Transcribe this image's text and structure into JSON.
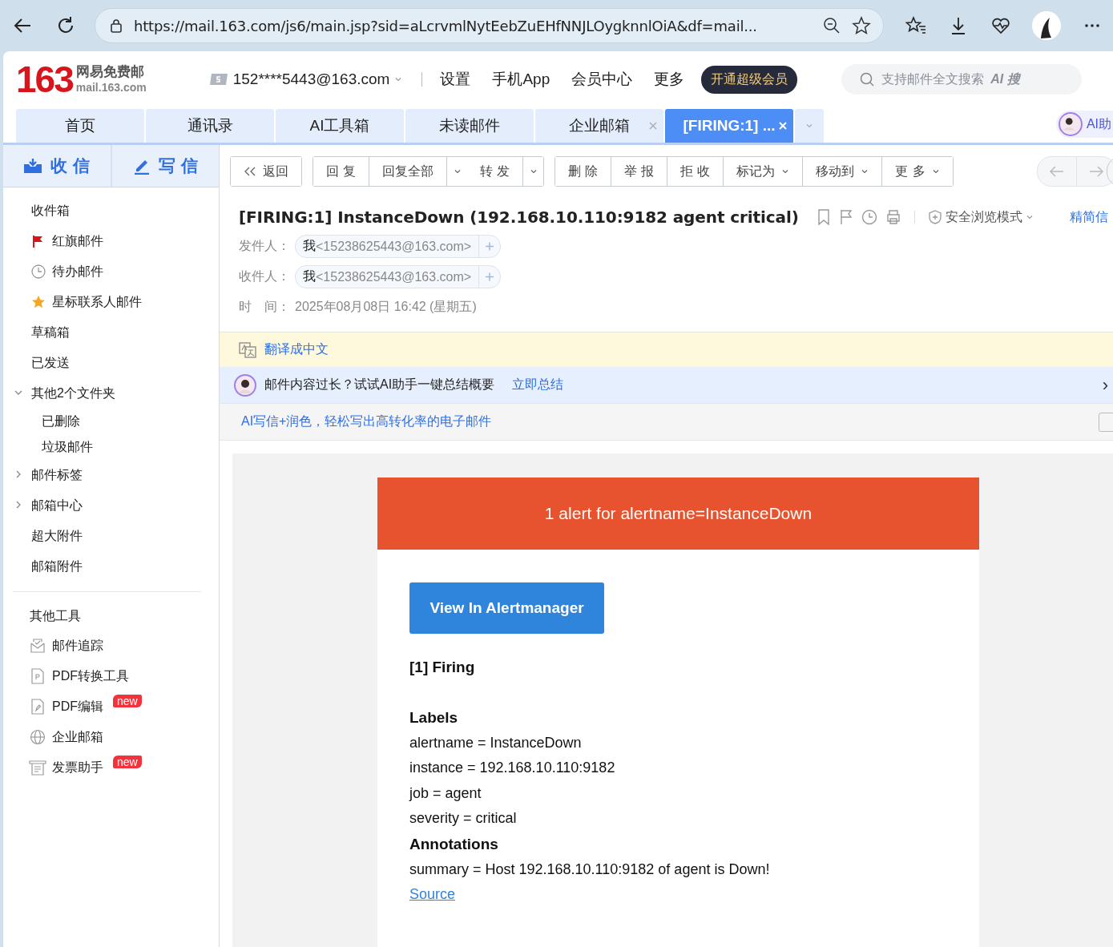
{
  "browser": {
    "url": "https://mail.163.com/js6/main.jsp?sid=aLcrvmlNytEebZuEHfNNJLOygknnlOiA&df=mail..."
  },
  "header": {
    "logo_number": "163",
    "logo_name": "网易免费邮",
    "logo_domain": "mail.163.com",
    "account": "152****5443@163.com",
    "links": [
      "设置",
      "手机App",
      "会员中心",
      "更多"
    ],
    "vip_button": "开通超级会员",
    "search": {
      "placeholder": "支持邮件全文搜索"
    },
    "ai_search": "AI 搜"
  },
  "tabs": [
    {
      "label": "首页",
      "selected": false,
      "closable": false
    },
    {
      "label": "通讯录",
      "selected": false,
      "closable": false
    },
    {
      "label": "AI工具箱",
      "selected": false,
      "closable": false
    },
    {
      "label": "未读邮件",
      "selected": false,
      "closable": false
    },
    {
      "label": "企业邮箱",
      "selected": false,
      "closable": true
    },
    {
      "label": "[FIRING:1] ...",
      "selected": true,
      "closable": true
    }
  ],
  "ai_assistant": "AI助",
  "sidebar": {
    "receive": "收 信",
    "write": "写 信",
    "folders": [
      {
        "label": "收件箱",
        "kind": "plain"
      },
      {
        "label": "红旗邮件",
        "kind": "flag"
      },
      {
        "label": "待办邮件",
        "kind": "clock"
      },
      {
        "label": "星标联系人邮件",
        "kind": "star"
      },
      {
        "label": "草稿箱",
        "kind": "plain"
      },
      {
        "label": "已发送",
        "kind": "plain"
      },
      {
        "label": "其他2个文件夹",
        "kind": "group",
        "expanded": true,
        "children": [
          {
            "label": "已删除"
          },
          {
            "label": "垃圾邮件"
          }
        ]
      },
      {
        "label": "邮件标签",
        "kind": "group",
        "expanded": false
      },
      {
        "label": "邮箱中心",
        "kind": "group",
        "expanded": false
      },
      {
        "label": "超大附件",
        "kind": "plain"
      },
      {
        "label": "邮箱附件",
        "kind": "plain"
      }
    ],
    "tools_title": "其他工具",
    "tools": [
      {
        "label": "邮件追踪",
        "kind": "envelope"
      },
      {
        "label": "PDF转换工具",
        "kind": "pdf"
      },
      {
        "label": "PDF编辑",
        "kind": "pdf-edit",
        "badge": "new"
      },
      {
        "label": "企业邮箱",
        "kind": "globe"
      },
      {
        "label": "发票助手",
        "kind": "invoice",
        "badge": "new"
      }
    ]
  },
  "toolbar": [
    [
      {
        "label": "返回",
        "kind": "back"
      }
    ],
    [
      {
        "label": "回 复",
        "kind": "button"
      },
      {
        "label": "回复全部",
        "kind": "button",
        "dropdown": true
      },
      {
        "label": "转 发",
        "kind": "button",
        "dropdown": true
      }
    ],
    [
      {
        "label": "删 除",
        "kind": "button"
      },
      {
        "label": "举 报",
        "kind": "button"
      },
      {
        "label": "拒 收",
        "kind": "button"
      },
      {
        "label": "标记为",
        "kind": "button",
        "dropdown": true
      },
      {
        "label": "移动到",
        "kind": "button",
        "dropdown": true
      },
      {
        "label": "更 多",
        "kind": "button",
        "dropdown": true
      }
    ]
  ],
  "message": {
    "subject": "[FIRING:1] InstanceDown (192.168.10.110:9182 agent critical)",
    "safe_mode": "安全浏览模式",
    "brief_link": "精简信",
    "from": {
      "label": "发件人：",
      "name": "我",
      "address": "<15238625443@163.com>"
    },
    "to": {
      "label": "收件人：",
      "name": "我",
      "address": "<15238625443@163.com>"
    },
    "time": {
      "label": "时　间：",
      "value": "2025年08月08日 16:42 (星期五)"
    },
    "translate": "翻译成中文",
    "ai_banner": {
      "text": "邮件内容过长？试试AI助手一键总结概要",
      "link": "立即总结",
      "close": "›"
    },
    "ai_write": "AI写信+润色，轻松写出高转化率的电子邮件"
  },
  "email": {
    "banner": "1 alert for alertname=InstanceDown",
    "button": "View In Alertmanager",
    "firing": "[1] Firing",
    "labels_title": "Labels",
    "labels": [
      "alertname = InstanceDown",
      "instance = 192.168.10.110:9182",
      "job = agent",
      "severity = critical"
    ],
    "annotations_title": "Annotations",
    "annotations": [
      "summary = Host 192.168.10.110:9182 of agent is Down!"
    ],
    "source_link": "Source"
  }
}
